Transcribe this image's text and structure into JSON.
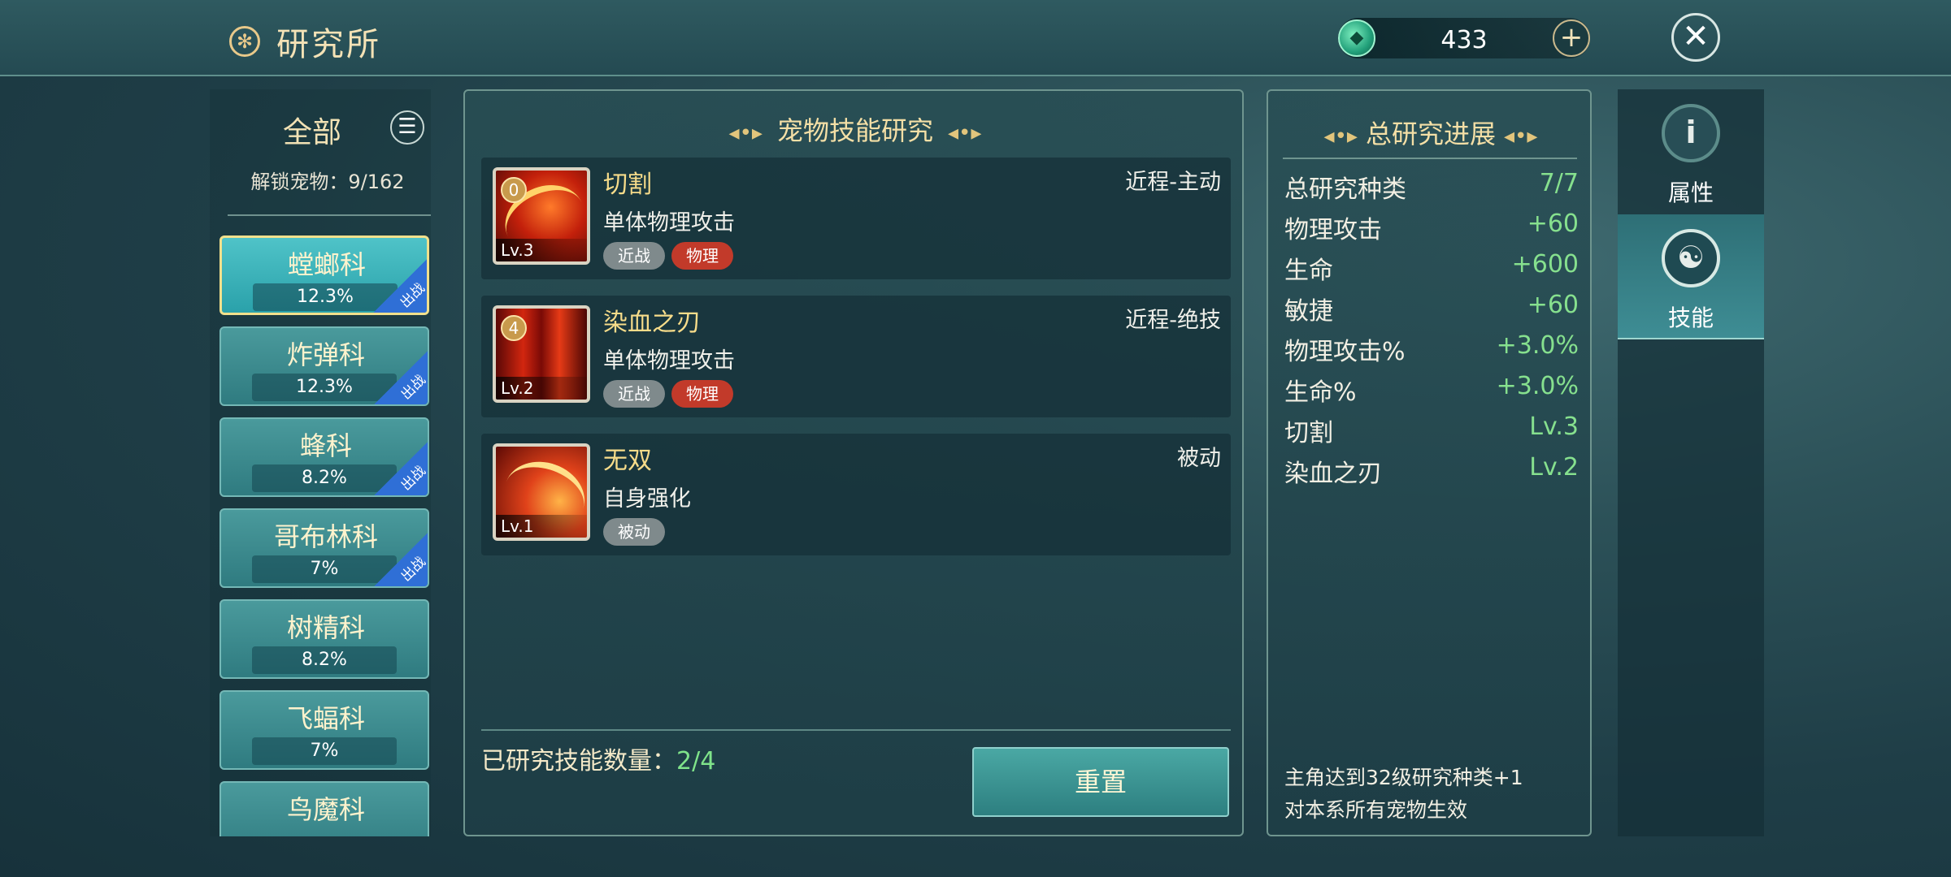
{
  "header": {
    "title": "研究所",
    "title_icon": "settings-icon",
    "currency_icon": "green-gem-icon",
    "currency_value": "433",
    "plus_label": "+",
    "close_label": "✕"
  },
  "sidebar": {
    "title": "全部",
    "menu_icon": "☰",
    "unlock_text": "解锁宠物：9/162",
    "categories": [
      {
        "name": "螳螂科",
        "percent": "12.3%",
        "flag": "出战",
        "selected": true
      },
      {
        "name": "炸弹科",
        "percent": "12.3%",
        "flag": "出战"
      },
      {
        "name": "蜂科",
        "percent": "8.2%",
        "flag": "出战"
      },
      {
        "name": "哥布林科",
        "percent": "7%",
        "flag": "出战"
      },
      {
        "name": "树精科",
        "percent": "8.2%"
      },
      {
        "name": "飞蝠科",
        "percent": "7%"
      },
      {
        "name": "鸟魔科",
        "percent": ""
      }
    ]
  },
  "center": {
    "title": "宠物技能研究",
    "skills": [
      {
        "name": "切割",
        "type": "近程-主动",
        "desc": "单体物理攻击",
        "level": "Lv.3",
        "badge": "0",
        "tags": [
          "近战",
          "物理"
        ]
      },
      {
        "name": "染血之刃",
        "type": "近程-绝技",
        "desc": "单体物理攻击",
        "level": "Lv.2",
        "badge": "4",
        "tags": [
          "近战",
          "物理"
        ]
      },
      {
        "name": "无双",
        "type": "被动",
        "desc": "自身强化",
        "level": "Lv.1",
        "badge": "",
        "tags": [
          "被动"
        ]
      }
    ],
    "researched_label": "已研究技能数量：",
    "researched_value": "2/4",
    "reset_label": "重置"
  },
  "summary": {
    "title": "总研究进展",
    "stats": [
      {
        "label": "总研究种类",
        "value": "7/7"
      },
      {
        "label": "物理攻击",
        "value": "+60"
      },
      {
        "label": "生命",
        "value": "+600"
      },
      {
        "label": "敏捷",
        "value": "+60"
      },
      {
        "label": "物理攻击%",
        "value": "+3.0%"
      },
      {
        "label": "生命%",
        "value": "+3.0%"
      },
      {
        "label": "切割",
        "value": "Lv.3"
      },
      {
        "label": "染血之刃",
        "value": "Lv.2"
      }
    ],
    "note_line1": "主角达到32级研究种类+1",
    "note_line2": "对本系所有宠物生效"
  },
  "tabs": [
    {
      "label": "属性",
      "icon": "info-icon",
      "glyph": "i",
      "active": false
    },
    {
      "label": "技能",
      "icon": "skill-icon",
      "glyph": "☯",
      "active": true
    }
  ],
  "colors": {
    "accent_gold": "#f4dfa6",
    "value_green": "#86e08e",
    "tag_red": "#c23a2a",
    "selected_border": "#f1e08c",
    "flag_blue": "#2f6fd6"
  }
}
